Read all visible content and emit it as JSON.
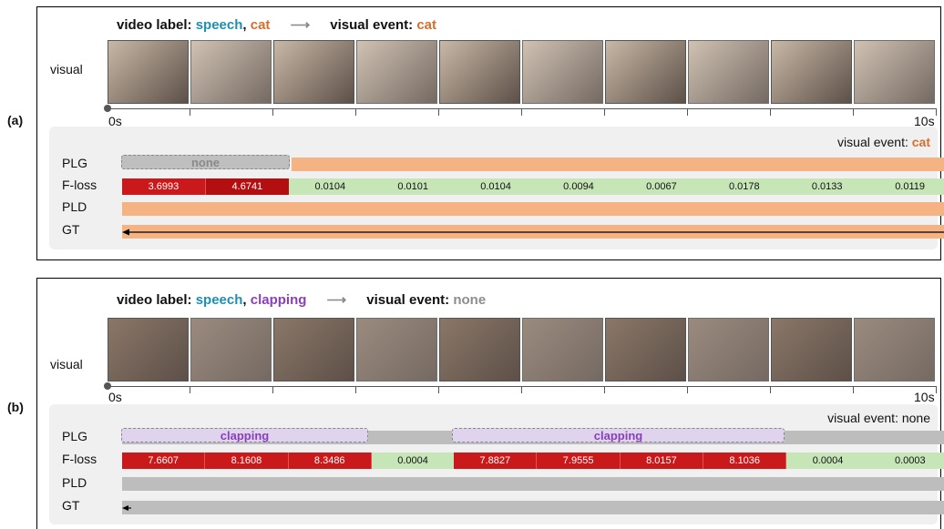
{
  "panel_a": {
    "label": "(a)",
    "header_prefix": "video label: ",
    "label_speech": "speech",
    "comma": ",",
    "label_second": "cat",
    "arrow": "⟶",
    "event_prefix": "visual event: ",
    "event_value": "cat",
    "visual_label": "visual",
    "t_start": "0s",
    "t_end": "10s",
    "lower_event_prefix": "visual event: ",
    "lower_event_value": "cat",
    "rows": {
      "plg": "PLG",
      "floss": "F-loss",
      "pld": "PLD",
      "gt": "GT"
    },
    "plg_none": "none",
    "floss": [
      "3.6993",
      "4.6741",
      "0.0104",
      "0.0101",
      "0.0104",
      "0.0094",
      "0.0067",
      "0.0178",
      "0.0133",
      "0.0119"
    ],
    "floss_kind": [
      "red",
      "red2",
      "green",
      "green",
      "green",
      "green",
      "green",
      "green",
      "green",
      "green"
    ],
    "colors": {
      "bar": "#f5b383",
      "frame": "#c8b8a6"
    }
  },
  "panel_b": {
    "label": "(b)",
    "header_prefix": "video label: ",
    "label_speech": "speech",
    "comma": ",",
    "label_second": "clapping",
    "arrow": "⟶",
    "event_prefix": "visual event: ",
    "event_value": "none",
    "visual_label": "visual",
    "t_start": "0s",
    "t_end": "10s",
    "lower_event": "visual event: none",
    "rows": {
      "plg": "PLG",
      "floss": "F-loss",
      "pld": "PLD",
      "gt": "GT"
    },
    "plg_clap_1": "clapping",
    "plg_clap_2": "clapping",
    "floss": [
      "7.6607",
      "8.1608",
      "8.3486",
      "0.0004",
      "7.8827",
      "7.9555",
      "8.0157",
      "8.1036",
      "0.0004",
      "0.0003"
    ],
    "floss_kind": [
      "red",
      "red",
      "red",
      "green",
      "red",
      "red",
      "red",
      "red",
      "green",
      "green"
    ],
    "colors": {
      "bar": "#bdbdbd",
      "frame": "#8a7768"
    }
  }
}
